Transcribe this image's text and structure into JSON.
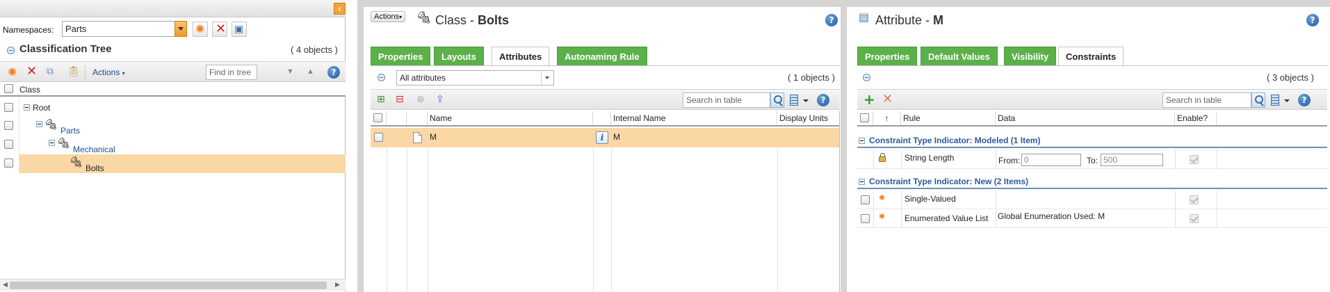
{
  "left": {
    "namespaces_label": "Namespaces:",
    "namespace_value": "Parts",
    "tree_title": "Classification Tree",
    "tree_count": "( 4 objects )",
    "actions_label": "Actions",
    "find_placeholder": "Find in tree",
    "column_header": "Class",
    "tree": [
      {
        "label": "Root",
        "level": 0
      },
      {
        "label": "Parts",
        "level": 1
      },
      {
        "label": "Mechanical",
        "level": 2
      },
      {
        "label": "Bolts",
        "level": 3,
        "selected": true
      }
    ]
  },
  "center": {
    "actions_label": "Actions",
    "title_prefix": "Class - ",
    "title_name": "Bolts",
    "tabs": [
      {
        "label": "Properties",
        "active": false
      },
      {
        "label": "Layouts",
        "active": false
      },
      {
        "label": "Attributes",
        "active": true
      },
      {
        "label": "Autonaming Rule",
        "active": false
      }
    ],
    "filter_value": "All attributes",
    "count": "( 1 objects )",
    "search_placeholder": "Search in table",
    "columns": [
      "Name",
      "Internal Name",
      "Display Units"
    ],
    "rows": [
      {
        "name": "M",
        "internal_name": "M",
        "display_units": ""
      }
    ]
  },
  "right": {
    "title_prefix": "Attribute - ",
    "title_name": "M",
    "tabs": [
      {
        "label": "Properties",
        "active": false
      },
      {
        "label": "Default Values",
        "active": false
      },
      {
        "label": "Visibility",
        "active": false
      },
      {
        "label": "Constraints",
        "active": true
      }
    ],
    "count": "( 3 objects )",
    "search_placeholder": "Search in table",
    "columns": {
      "sort": "↑",
      "rule": "Rule",
      "data": "Data",
      "enable": "Enable?"
    },
    "groups": [
      {
        "title": "Constraint Type Indicator: Modeled (1 Item)",
        "rows": [
          {
            "rule": "String Length",
            "from_label": "From:",
            "from_value": "0",
            "to_label": "To:",
            "to_value": "500"
          }
        ]
      },
      {
        "title": "Constraint Type Indicator: New (2 Items)",
        "rows": [
          {
            "rule": "Single-Valued",
            "data": ""
          },
          {
            "rule": "Enumerated Value List",
            "data": "Global Enumeration Used: M"
          }
        ]
      }
    ]
  },
  "colors": {
    "tab_green": "#5bb04a",
    "selected_row": "#fad7a5",
    "link_blue": "#1d4e8f",
    "group_blue": "#2a5a9a"
  }
}
